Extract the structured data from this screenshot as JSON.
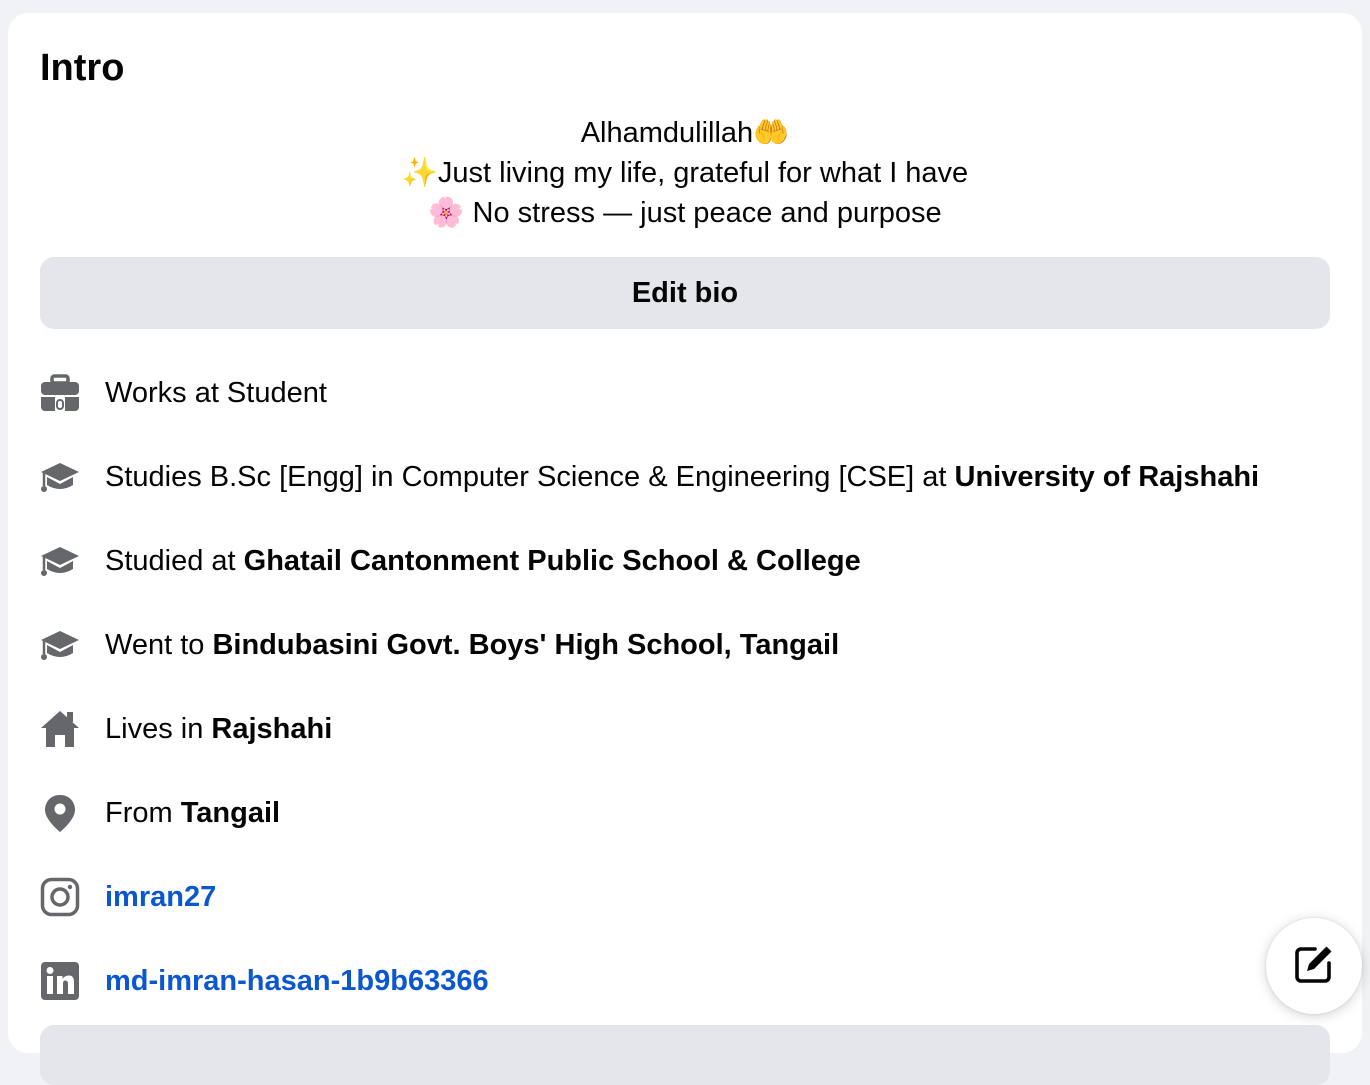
{
  "intro": {
    "title": "Intro",
    "bio_lines": [
      "Alhamdulillah🤲",
      "✨Just living my life, grateful for what I have",
      "🌸 No stress — just peace and purpose"
    ],
    "edit_bio_label": "Edit bio"
  },
  "details": [
    {
      "icon": "briefcase-icon",
      "prefix": "Works at Student",
      "emphasis": ""
    },
    {
      "icon": "graduation-cap-icon",
      "prefix": "Studies B.Sc [Engg] in Computer Science & Engineering [CSE] at ",
      "emphasis": "University of Rajshahi"
    },
    {
      "icon": "graduation-cap-icon",
      "prefix": "Studied at ",
      "emphasis": "Ghatail Cantonment Public School & College"
    },
    {
      "icon": "graduation-cap-icon",
      "prefix": "Went to ",
      "emphasis": "Bindubasini Govt. Boys' High School, Tangail"
    },
    {
      "icon": "home-icon",
      "prefix": "Lives in ",
      "emphasis": "Rajshahi"
    },
    {
      "icon": "location-pin-icon",
      "prefix": "From ",
      "emphasis": "Tangail"
    }
  ],
  "links": {
    "instagram": {
      "icon": "instagram-icon",
      "label": "imran27"
    },
    "linkedin": {
      "icon": "linkedin-icon",
      "label": "md-imran-hasan-1b9b63366"
    }
  },
  "colors": {
    "link": "#0b57d0",
    "icon": "#65676b",
    "button_bg": "#e4e6eb",
    "page_bg": "#f0f2f5"
  },
  "fab": {
    "icon": "compose-icon"
  }
}
